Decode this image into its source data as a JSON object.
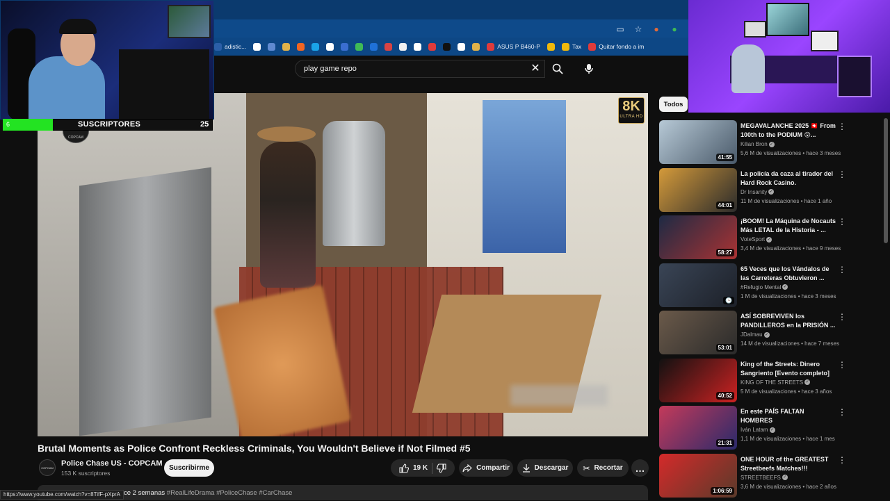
{
  "browser": {
    "bookmarks": [
      {
        "label": "adistic...",
        "color": "#2b5fa8"
      },
      {
        "label": "",
        "color": "#ffffff"
      },
      {
        "label": "",
        "color": "#5f8ad1"
      },
      {
        "label": "",
        "color": "#e0b24a"
      },
      {
        "label": "",
        "color": "#f16522"
      },
      {
        "label": "",
        "color": "#1aa3e8"
      },
      {
        "label": "",
        "color": "#ffffff"
      },
      {
        "label": "",
        "color": "#3a6ed0"
      },
      {
        "label": "",
        "color": "#3fba56"
      },
      {
        "label": "",
        "color": "#1f71d8"
      },
      {
        "label": "",
        "color": "#d84343"
      },
      {
        "label": "",
        "color": "#f1f1f1"
      },
      {
        "label": "",
        "color": "#ffffff"
      },
      {
        "label": "",
        "color": "#e03b3b"
      },
      {
        "label": "",
        "color": "#111111"
      },
      {
        "label": "",
        "color": "#ffffff"
      },
      {
        "label": "",
        "color": "#e0b24a"
      },
      {
        "label": "ASUS P B460-P",
        "color": "#e03b3b"
      },
      {
        "label": "",
        "color": "#f0b90b"
      },
      {
        "label": "Tax",
        "color": "#f0b90b"
      },
      {
        "label": "Quitar fondo a im",
        "color": "#e03b3b"
      }
    ]
  },
  "search": {
    "value": "play game repo"
  },
  "player": {
    "badge_big": "8K",
    "badge_small": "ULTRA HD",
    "cam_logo": "COPCAM"
  },
  "overlay": {
    "sub_current": "6",
    "sub_label": "SUSCRIPTORES",
    "sub_goal": "25",
    "sub_progress": 0.24
  },
  "video": {
    "title": "Brutal Moments as Police Confront Reckless Criminals, You Wouldn't Believe if Not Filmed #5",
    "channel": "Police Chase US - COPCAM",
    "channel_avatar": "COPCAM",
    "subs": "153 K suscriptores",
    "subscribe": "Suscribirme",
    "likes": "19 K",
    "share": "Compartir",
    "download": "Descargar",
    "clip": "Recortar",
    "more": "…",
    "desc_date": "ce 2 semanas",
    "desc_tags": "#RealLifeDrama #PoliceChase #CarChase",
    "status_url": "https://www.youtube.com/watch?v=8TifF-pXprA"
  },
  "sidebar": {
    "chip": "Todos",
    "items": [
      {
        "title": "MEGAVALANCHE 2025 🇨🇭 From 100th to the PODIUM 😲...",
        "channel": "Kilian Bron",
        "meta": "5,6 M de visualizaciones • hace 3 meses",
        "duration": "41:55",
        "thumb": [
          "#b7c9d6",
          "#4a5a6a"
        ]
      },
      {
        "title": "La policía da caza al tirador del Hard Rock Casino.",
        "channel": "Dr Insanity",
        "meta": "11 M de visualizaciones • hace 1 año",
        "duration": "44:01",
        "thumb": [
          "#d49a3a",
          "#2b2b2b"
        ]
      },
      {
        "title": "¡BOOM! La Máquina de Nocauts Más LETAL de la Historia - ...",
        "channel": "VoteSport",
        "meta": "3,4 M de visualizaciones • hace 9 meses",
        "duration": "58:27",
        "thumb": [
          "#1d2a44",
          "#a33"
        ]
      },
      {
        "title": "65 Veces que los Vándalos de las Carreteras Obtuvieron ...",
        "channel": "#Refugio Mental",
        "meta": "1 M de visualizaciones • hace 3 meses",
        "duration": "",
        "thumb": [
          "#3a4556",
          "#1c2028"
        ]
      },
      {
        "title": "ASÍ SOBREVIVEN los PANDILLEROS en la PRISIÓN ...",
        "channel": "JDalmau",
        "meta": "14 M de visualizaciones • hace 7 meses",
        "duration": "53:01",
        "thumb": [
          "#6b5a4a",
          "#2a2a2a"
        ]
      },
      {
        "title": "King of the Streets: Dinero Sangriento [Evento completo]",
        "channel": "KING OF THE STREETS",
        "meta": "5 M de visualizaciones • hace 3 años",
        "duration": "40:52",
        "thumb": [
          "#111",
          "#c22"
        ]
      },
      {
        "title": "En este PAÍS FALTAN HOMBRES",
        "channel": "Iván Latam",
        "meta": "1,1 M de visualizaciones • hace 1 mes",
        "duration": "21:31",
        "thumb": [
          "#c43a5a",
          "#2a2a6a"
        ]
      },
      {
        "title": "ONE HOUR of the GREATEST Streetbeefs Matches!!!",
        "channel": "STREETBEEFS",
        "meta": "3,6 M de visualizaciones • hace 2 años",
        "duration": "1:06:59",
        "thumb": [
          "#d42a2a",
          "#5a3a2a"
        ]
      }
    ]
  }
}
